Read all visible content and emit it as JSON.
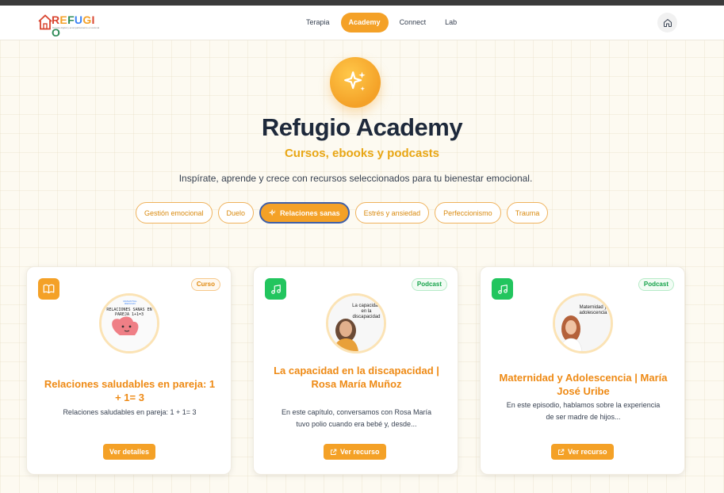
{
  "brand": {
    "logo_text": "REFUGIO",
    "logo_tagline": "Terapia digital y acompañamiento emocional",
    "accent": "#f4a127",
    "title_color": "#1e293b",
    "subtitle_color": "#e8a614"
  },
  "nav": {
    "items": [
      {
        "label": "Terapia",
        "active": false
      },
      {
        "label": "Academy",
        "active": true
      },
      {
        "label": "Connect",
        "active": false
      },
      {
        "label": "Lab",
        "active": false
      }
    ],
    "home_icon": "home-icon"
  },
  "hero": {
    "icon": "sparkles-icon",
    "title": "Refugio Academy",
    "subtitle": "Cursos, ebooks y podcasts",
    "description": "Inspírate, aprende y crece con recursos seleccionados para tu bienestar emocional."
  },
  "filters": [
    {
      "label": "Gestión emocional",
      "active": false
    },
    {
      "label": "Duelo",
      "active": false
    },
    {
      "label": "Relaciones sanas",
      "active": true
    },
    {
      "label": "Estrés y ansiedad",
      "active": false
    },
    {
      "label": "Perfeccionismo",
      "active": false
    },
    {
      "label": "Trauma",
      "active": false
    }
  ],
  "cards": [
    {
      "type_icon": "book-icon",
      "badge": "Curso",
      "thumb_text": "RELACIONES SANAS EN PAREJA 1+1=3",
      "thumb_logo": "MANANTIAL REFUGIO",
      "title": "Relaciones saludables en pareja: 1 + 1= 3",
      "description": "Relaciones saludables en pareja: 1 + 1= 3",
      "button": "Ver detalles"
    },
    {
      "type_icon": "music-icon",
      "badge": "Podcast",
      "thumb_text": "La capacidad en la discapacidad",
      "title": "La capacidad en la discapacidad | Rosa María Muñoz",
      "description": "En este capítulo, conversamos con Rosa María tuvo polio cuando era bebé y, desde...",
      "button": "Ver recurso"
    },
    {
      "type_icon": "music-icon",
      "badge": "Podcast",
      "thumb_text": "Maternidad y adolescencia",
      "title": "Maternidad y Adolescencia | María José Uribe",
      "description": "En este episodio, hablamos sobre la experiencia de ser madre de hijos...",
      "button": "Ver recurso"
    }
  ]
}
